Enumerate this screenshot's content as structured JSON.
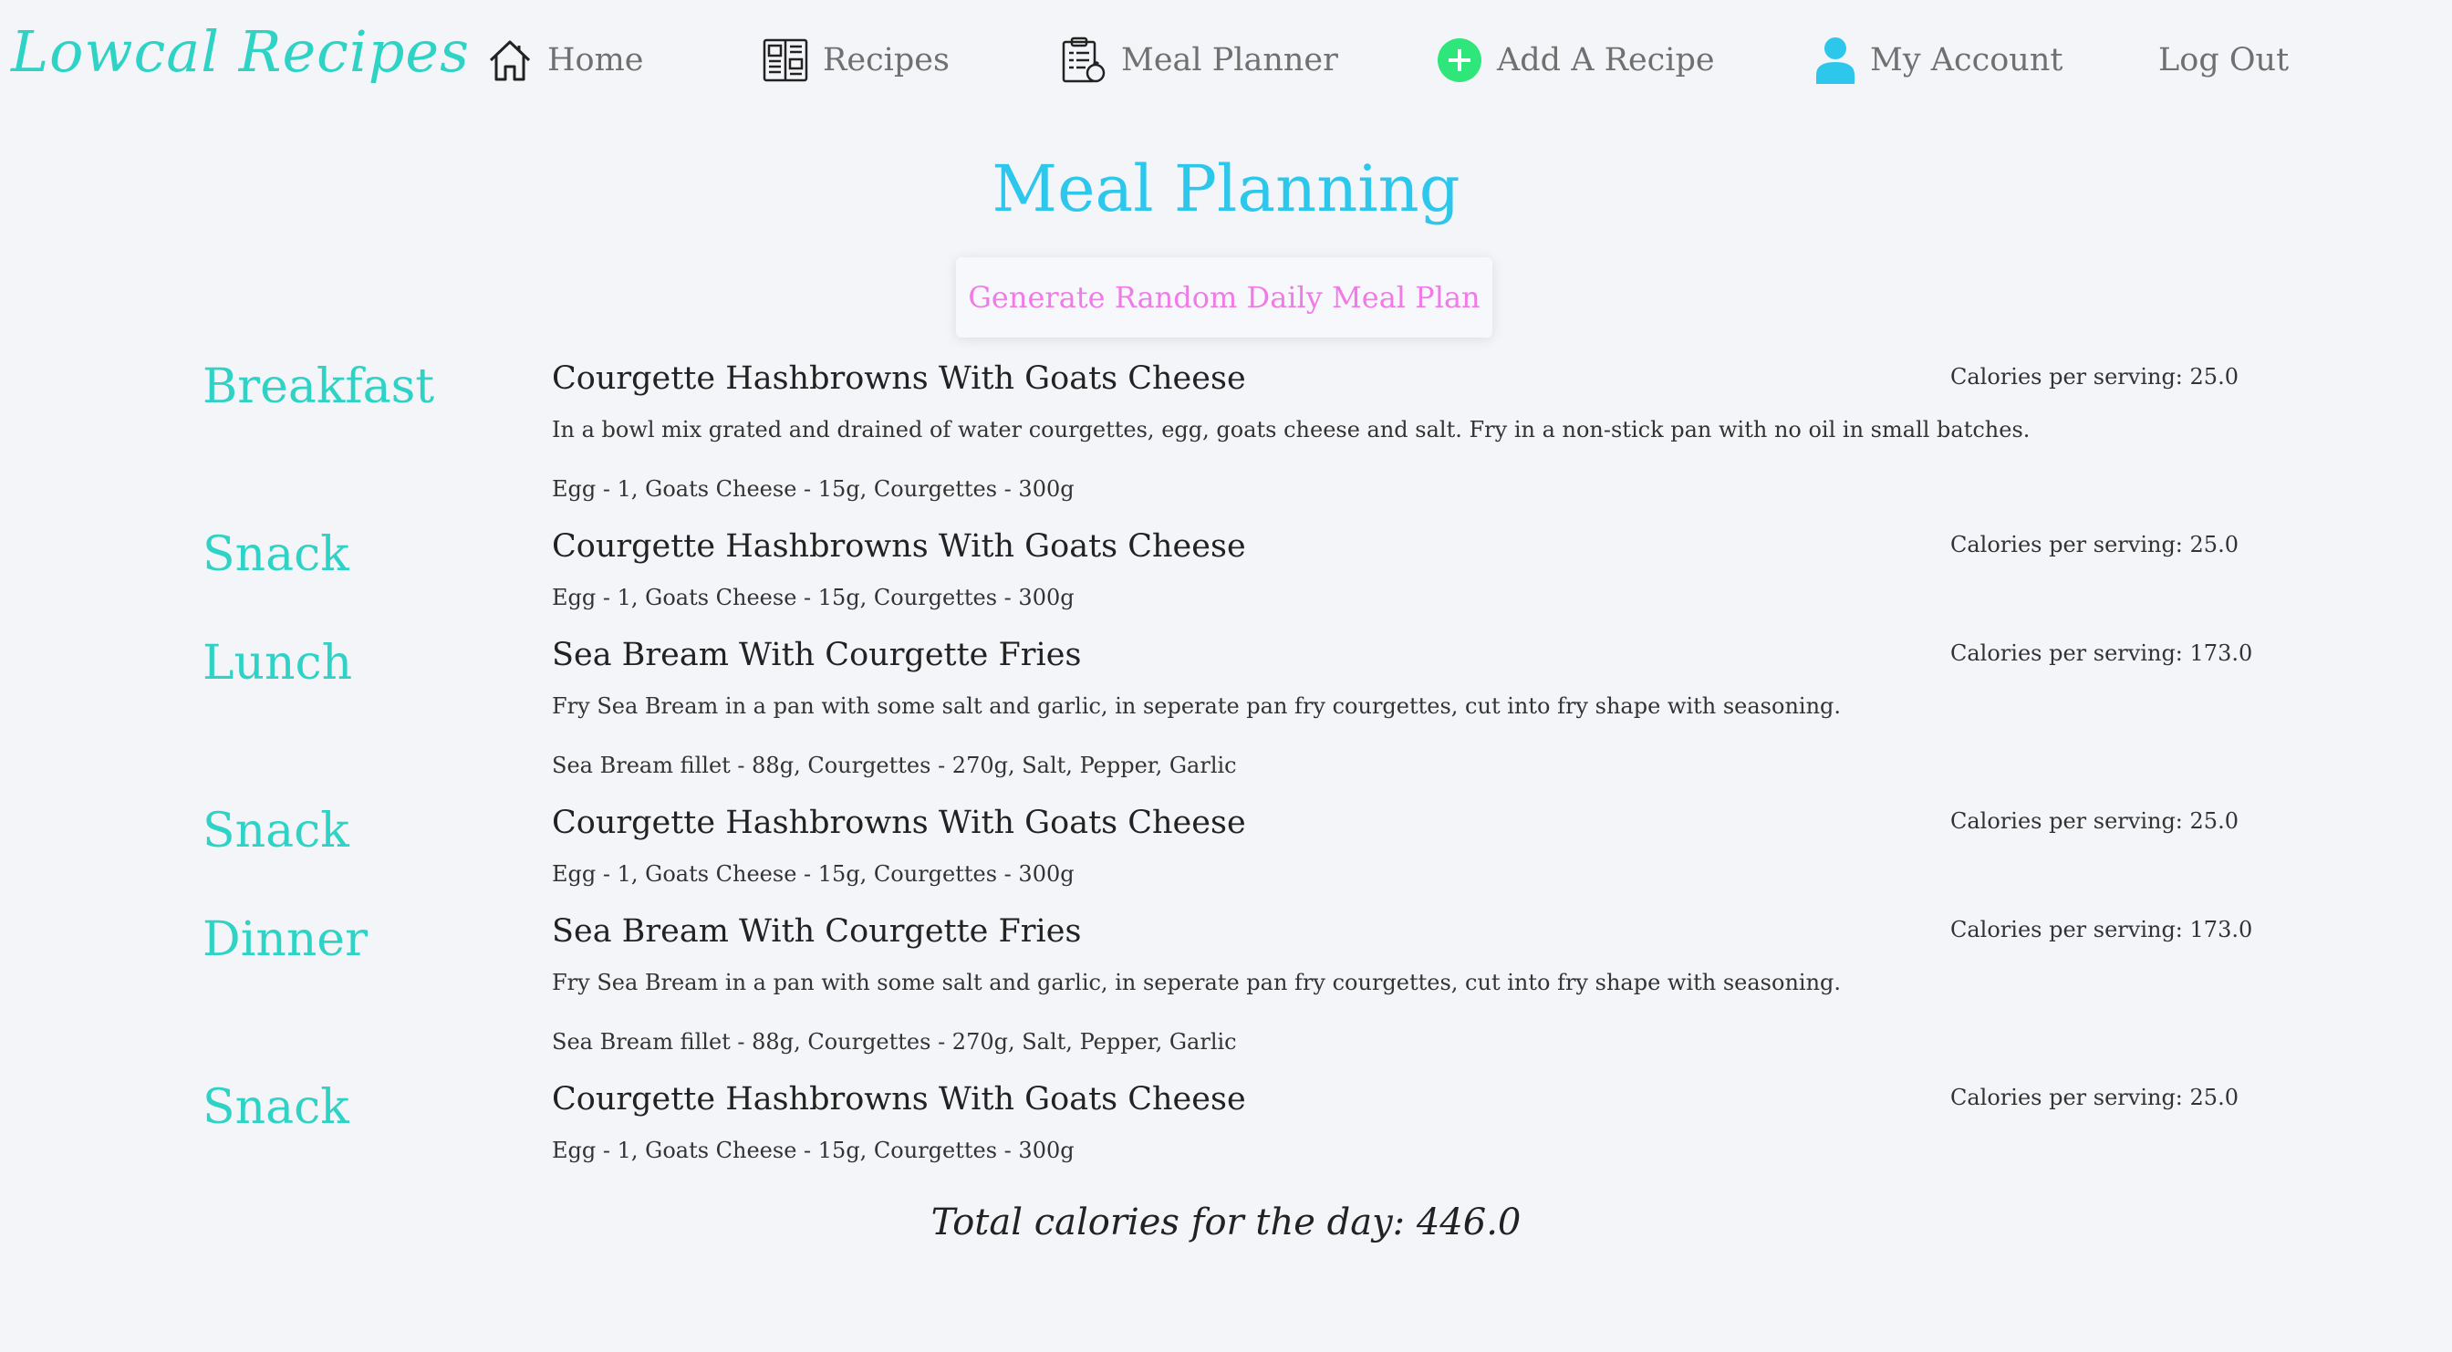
{
  "nav": {
    "logo": "Lowcal Recipes",
    "home": "Home",
    "recipes": "Recipes",
    "meal_planner": "Meal Planner",
    "add_recipe": "Add A Recipe",
    "my_account": "My Account",
    "log_out": "Log Out",
    "icons": {
      "home": "home-icon",
      "recipes": "recipe-book-icon",
      "meal_planner": "clipboard-icon",
      "add_recipe": "plus-circle-icon",
      "my_account": "user-icon"
    },
    "colors": {
      "add_icon": "#2ee67a",
      "account_icon": "#2ec7ec"
    }
  },
  "page": {
    "title": "Meal Planning",
    "generate_button": "Generate Random Daily Meal Plan"
  },
  "meals": [
    {
      "label": "Breakfast",
      "recipe": "Courgette Hashbrowns With Goats Cheese",
      "description": "In a bowl mix grated and drained of water courgettes, egg, goats cheese and salt. Fry in a non-stick pan with no oil in small batches.",
      "ingredients": "Egg - 1, Goats Cheese - 15g, Courgettes - 300g",
      "calories": "Calories per serving: 25.0"
    },
    {
      "label": "Snack",
      "recipe": "Courgette Hashbrowns With Goats Cheese",
      "description": "",
      "ingredients": "Egg - 1, Goats Cheese - 15g, Courgettes - 300g",
      "calories": "Calories per serving: 25.0"
    },
    {
      "label": "Lunch",
      "recipe": "Sea Bream With Courgette Fries",
      "description": "Fry Sea Bream in a pan with some salt and garlic, in seperate pan fry courgettes, cut into fry shape with seasoning.",
      "ingredients": "Sea Bream fillet - 88g, Courgettes - 270g, Salt, Pepper, Garlic",
      "calories": "Calories per serving: 173.0"
    },
    {
      "label": "Snack",
      "recipe": "Courgette Hashbrowns With Goats Cheese",
      "description": "",
      "ingredients": "Egg - 1, Goats Cheese - 15g, Courgettes - 300g",
      "calories": "Calories per serving: 25.0"
    },
    {
      "label": "Dinner",
      "recipe": "Sea Bream With Courgette Fries",
      "description": "Fry Sea Bream in a pan with some salt and garlic, in seperate pan fry courgettes, cut into fry shape with seasoning.",
      "ingredients": "Sea Bream fillet - 88g, Courgettes - 270g, Salt, Pepper, Garlic",
      "calories": "Calories per serving: 173.0"
    },
    {
      "label": "Snack",
      "recipe": "Courgette Hashbrowns With Goats Cheese",
      "description": "",
      "ingredients": "Egg - 1, Goats Cheese - 15g, Courgettes - 300g",
      "calories": "Calories per serving: 25.0"
    }
  ],
  "total": "Total calories for the day: 446.0"
}
